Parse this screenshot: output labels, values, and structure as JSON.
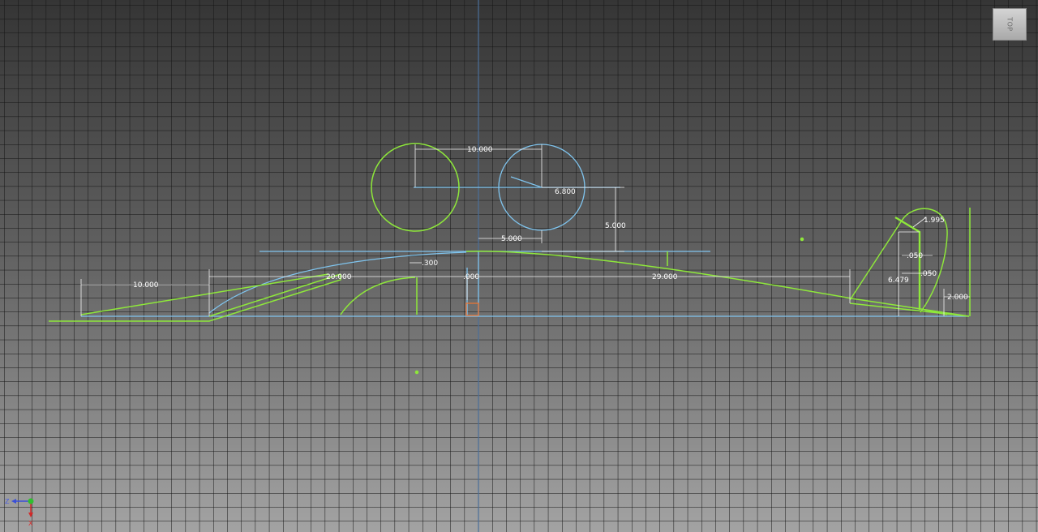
{
  "viewcube": {
    "face_label": "TOP"
  },
  "triad": {
    "axis_z": "Z",
    "axis_x": "X"
  },
  "colors": {
    "sketch_geometry": "#8ee83a",
    "construction_geometry": "#7fc4ee",
    "dimension": "#ffffff",
    "grid_line": "#141414",
    "sketch_origin": "#4a6f9a"
  },
  "dimensions": [
    {
      "name": "dimension-10-000-top",
      "value": "10.000"
    },
    {
      "name": "dimension-6-800",
      "value": "6.800"
    },
    {
      "name": "dimension-5-000-vertical",
      "value": "5.000"
    },
    {
      "name": "dimension-5-000-horizontal",
      "value": "5.000"
    },
    {
      "name": "dimension-10-000-left",
      "value": "10.000"
    },
    {
      "name": "dimension-20-000",
      "value": "20.000"
    },
    {
      "name": "dimension-300",
      "value": ".300"
    },
    {
      "name": "dimension-000",
      "value": ".000"
    },
    {
      "name": "dimension-29-000",
      "value": "29.000"
    },
    {
      "name": "dimension-1-995",
      "value": "1.995"
    },
    {
      "name": "dimension-050-a",
      "value": ".050"
    },
    {
      "name": "dimension-050-b",
      "value": ".050"
    },
    {
      "name": "dimension-6-479",
      "value": "6.479"
    },
    {
      "name": "dimension-2-000",
      "value": "2.000"
    }
  ]
}
